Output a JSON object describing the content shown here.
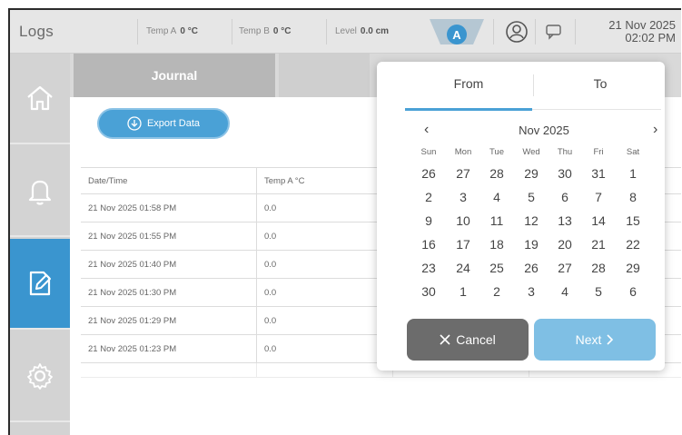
{
  "header": {
    "title": "Logs",
    "temp_a_label": "Temp A",
    "temp_a_value": "0 °C",
    "temp_b_label": "Temp B",
    "temp_b_value": "0 °C",
    "level_label": "Level",
    "level_value": "0.0 cm",
    "mode_badge": "A",
    "date": "21 Nov 2025",
    "time": "02:02 PM"
  },
  "sidebar": {
    "items": [
      {
        "name": "home",
        "icon": "home-icon"
      },
      {
        "name": "alarms",
        "icon": "bell-icon"
      },
      {
        "name": "logs",
        "icon": "edit-document-icon",
        "active": true
      },
      {
        "name": "settings",
        "icon": "gear-icon"
      }
    ]
  },
  "tabs": [
    {
      "label": "Journal"
    }
  ],
  "export_button": {
    "label": "Export Data",
    "icon": "download-icon"
  },
  "table": {
    "columns": [
      "Date/Time",
      "Temp A °C"
    ],
    "rows": [
      [
        "21 Nov 2025 01:58 PM",
        "0.0"
      ],
      [
        "21 Nov 2025 01:55 PM",
        "0.0"
      ],
      [
        "21 Nov 2025 01:40 PM",
        "0.0"
      ],
      [
        "21 Nov 2025 01:30 PM",
        "0.0"
      ],
      [
        "21 Nov 2025 01:29 PM",
        "0.0"
      ],
      [
        "21 Nov 2025 01:23 PM",
        "0.0"
      ]
    ]
  },
  "date_picker": {
    "tab_from": "From",
    "tab_to": "To",
    "prev": "‹",
    "next": "›",
    "month": "Nov 2025",
    "weekdays": [
      "Sun",
      "Mon",
      "Tue",
      "Wed",
      "Thu",
      "Fri",
      "Sat"
    ],
    "weeks": [
      [
        "26",
        "27",
        "28",
        "29",
        "30",
        "31",
        "1"
      ],
      [
        "2",
        "3",
        "4",
        "5",
        "6",
        "7",
        "8"
      ],
      [
        "9",
        "10",
        "11",
        "12",
        "13",
        "14",
        "15"
      ],
      [
        "16",
        "17",
        "18",
        "19",
        "20",
        "21",
        "22"
      ],
      [
        "23",
        "24",
        "25",
        "26",
        "27",
        "28",
        "29"
      ],
      [
        "30",
        "1",
        "2",
        "3",
        "4",
        "5",
        "6"
      ]
    ],
    "cancel_label": "Cancel",
    "next_label": "Next",
    "colors": {
      "accent": "#4aa1d6",
      "cancel": "#6c6c6c",
      "next": "#7fbfe4"
    }
  }
}
